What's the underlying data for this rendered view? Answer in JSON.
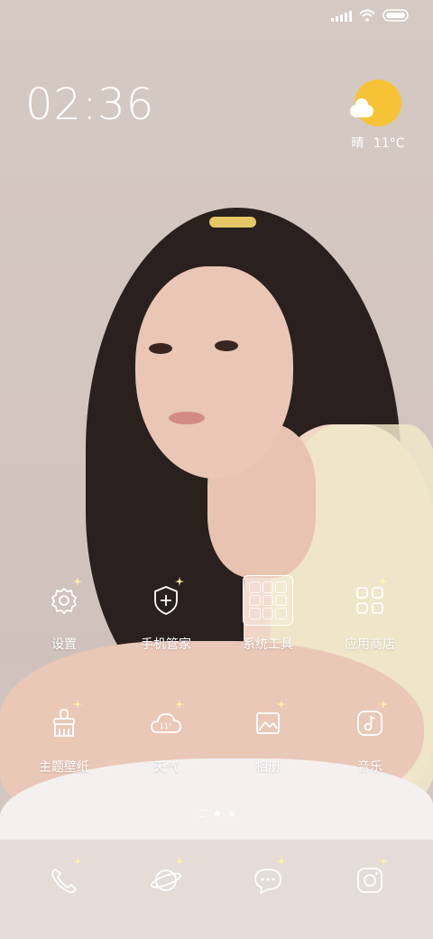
{
  "status_bar": {
    "signal_icon": "signal-icon",
    "wifi_icon": "wifi-icon",
    "battery_icon": "battery-icon"
  },
  "clock": {
    "time": "02:36"
  },
  "weather": {
    "condition": "晴",
    "temperature": "11°C",
    "icon": "sun-cloud-icon",
    "sun_color": "#f6c337"
  },
  "apps": [
    {
      "label": "设置",
      "icon": "gear-icon"
    },
    {
      "label": "手机管家",
      "icon": "shield-plus-icon"
    },
    {
      "label": "系统工具",
      "icon": "folder-icon"
    },
    {
      "label": "应用商店",
      "icon": "app-grid-icon"
    },
    {
      "label": "主题壁纸",
      "icon": "brush-icon"
    },
    {
      "label": "天气",
      "icon": "cloud-weather-icon",
      "icon_text": "11°"
    },
    {
      "label": "相册",
      "icon": "gallery-icon"
    },
    {
      "label": "音乐",
      "icon": "music-note-icon"
    }
  ],
  "dock": [
    {
      "icon": "phone-icon"
    },
    {
      "icon": "browser-planet-icon"
    },
    {
      "icon": "message-bubble-icon"
    },
    {
      "icon": "camera-icon"
    }
  ],
  "page_indicator": {
    "pages": 2,
    "active_page": 1
  }
}
